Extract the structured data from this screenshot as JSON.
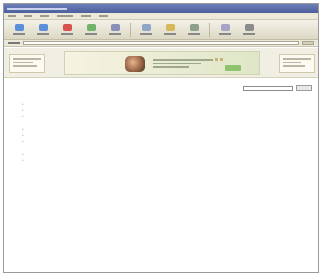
{
  "toolbar": {
    "buttons": [
      {
        "name": "back",
        "color": "#5b8fd9"
      },
      {
        "name": "forward",
        "color": "#5b8fd9"
      },
      {
        "name": "stop",
        "color": "#d9534f"
      },
      {
        "name": "refresh",
        "color": "#6fb46a"
      },
      {
        "name": "home",
        "color": "#8a8fb8"
      },
      {
        "name": "search",
        "color": "#8ea6c8"
      },
      {
        "name": "favorites",
        "color": "#d7b85a"
      },
      {
        "name": "history",
        "color": "#8fa08a"
      },
      {
        "name": "mail",
        "color": "#a7a3c7"
      },
      {
        "name": "print",
        "color": "#8b8b8b"
      }
    ]
  },
  "content": {
    "breadcrumb": "",
    "search_button": "",
    "title": "",
    "intro": "",
    "sections": [
      {
        "title": "",
        "items": [
          {
            "text": "",
            "link": ""
          },
          {
            "text": "",
            "link": ""
          },
          {
            "text": "",
            "link": ""
          }
        ]
      },
      {
        "title": "",
        "items": [
          {
            "text": "",
            "link": ""
          },
          {
            "text": "",
            "link": ""
          },
          {
            "text": "",
            "link": ""
          }
        ]
      },
      {
        "title": "",
        "items": [
          {
            "text": "",
            "link": ""
          },
          {
            "text": "",
            "link": ""
          }
        ]
      }
    ],
    "footer": {
      "text": "",
      "link": ""
    }
  }
}
